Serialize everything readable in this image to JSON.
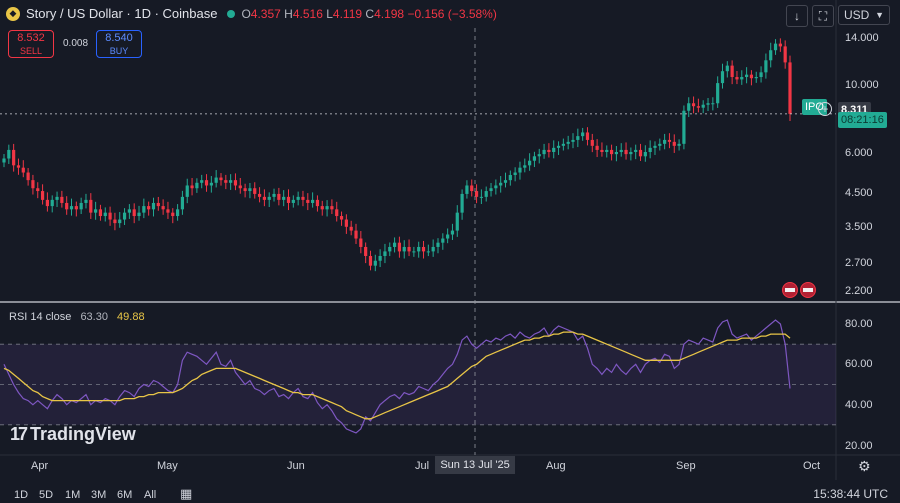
{
  "header": {
    "title": "Story / US Dollar · 1D · Coinbase",
    "open_label": "O",
    "open": "4.357",
    "high_label": "H",
    "high": "4.516",
    "low_label": "L",
    "low": "4.119",
    "close_label": "C",
    "close": "4.198",
    "change": "−0.156 (−3.58%)"
  },
  "trade": {
    "sell_price": "8.532",
    "sell_label": "SELL",
    "spread": "0.008",
    "buy_price": "8.540",
    "buy_label": "BUY"
  },
  "toolbar": {
    "currency": "USD"
  },
  "price_axis": {
    "ticks": [
      "14.000",
      "10.000",
      "8.311",
      "6.000",
      "4.500",
      "3.500",
      "2.700",
      "2.200"
    ],
    "last_price": "8.311",
    "ipo_label": "IPO",
    "countdown": "08:21:16"
  },
  "rsi": {
    "label": "RSI 14 close",
    "value": "63.30",
    "ma_value": "49.88",
    "ticks": [
      "80.00",
      "60.00",
      "40.00",
      "20.00"
    ]
  },
  "time_axis": {
    "labels": [
      "Apr",
      "May",
      "Jun",
      "Jul",
      "Aug",
      "Sep",
      "Oct"
    ],
    "crosshair_label": "Sun 13 Jul '25"
  },
  "watermark": "TradingView",
  "footer": {
    "ranges": [
      "1D",
      "5D",
      "1M",
      "3M",
      "6M",
      "All"
    ],
    "clock": "15:38:44 UTC"
  },
  "colors": {
    "background": "#161a25",
    "up": "#22ab94",
    "down": "#f23645",
    "rsi_line": "#7e57c2",
    "rsi_ma": "#e8c547",
    "accent": "#2962ff"
  },
  "chart_data": {
    "type": "candlestick",
    "y_scale": "log",
    "ylim": [
      2.0,
      16.0
    ],
    "x_range": [
      "2025-03-20",
      "2025-10-05"
    ],
    "closes": [
      5.9,
      6.3,
      5.6,
      5.5,
      5.3,
      5.0,
      4.7,
      4.6,
      4.3,
      4.1,
      4.3,
      4.4,
      4.2,
      4.0,
      4.1,
      4.0,
      4.2,
      4.3,
      3.9,
      4.0,
      3.8,
      3.9,
      3.7,
      3.6,
      3.7,
      3.9,
      4.0,
      3.8,
      3.9,
      4.1,
      4.0,
      4.2,
      4.1,
      4.0,
      3.9,
      3.8,
      4.0,
      4.4,
      4.8,
      4.7,
      4.9,
      5.0,
      4.8,
      4.9,
      5.1,
      5.0,
      4.9,
      5.0,
      4.8,
      4.7,
      4.6,
      4.7,
      4.5,
      4.4,
      4.3,
      4.4,
      4.5,
      4.3,
      4.4,
      4.2,
      4.3,
      4.4,
      4.3,
      4.2,
      4.3,
      4.1,
      4.0,
      4.1,
      4.0,
      3.8,
      3.7,
      3.5,
      3.4,
      3.2,
      3.0,
      2.8,
      2.6,
      2.7,
      2.8,
      2.9,
      3.0,
      3.1,
      2.9,
      3.0,
      2.9,
      2.9,
      3.0,
      2.9,
      2.9,
      3.0,
      3.1,
      3.2,
      3.3,
      3.4,
      3.9,
      4.5,
      4.8,
      4.6,
      4.4,
      4.4,
      4.6,
      4.7,
      4.8,
      4.9,
      5.0,
      5.2,
      5.3,
      5.5,
      5.6,
      5.8,
      6.0,
      6.1,
      6.3,
      6.2,
      6.4,
      6.5,
      6.6,
      6.7,
      6.8,
      7.0,
      7.2,
      6.8,
      6.5,
      6.3,
      6.2,
      6.3,
      6.1,
      6.2,
      6.3,
      6.1,
      6.2,
      6.3,
      6.0,
      6.2,
      6.4,
      6.5,
      6.6,
      6.8,
      6.7,
      6.5,
      6.6,
      8.5,
      9.0,
      8.8,
      8.7,
      8.9,
      9.0,
      9.0,
      10.5,
      11.5,
      12.0,
      11.0,
      10.8,
      11.0,
      11.2,
      10.9,
      11.0,
      11.4,
      12.5,
      13.5,
      14.2,
      13.9,
      12.3,
      8.3
    ],
    "rsi_y_range": [
      20,
      80
    ],
    "rsi_bands": [
      30,
      50,
      70
    ],
    "rsi": [
      60,
      55,
      50,
      46,
      43,
      42,
      40,
      42,
      40,
      38,
      42,
      45,
      43,
      40,
      42,
      41,
      43,
      45,
      40,
      42,
      41,
      43,
      42,
      40,
      44,
      47,
      46,
      44,
      48,
      50,
      49,
      52,
      51,
      49,
      47,
      46,
      50,
      62,
      66,
      65,
      64,
      62,
      60,
      63,
      66,
      60,
      59,
      62,
      56,
      53,
      50,
      52,
      48,
      47,
      45,
      47,
      48,
      44,
      45,
      43,
      46,
      48,
      44,
      43,
      46,
      41,
      38,
      40,
      37,
      33,
      31,
      28,
      27,
      26,
      28,
      34,
      32,
      36,
      40,
      42,
      44,
      45,
      43,
      46,
      45,
      46,
      49,
      48,
      47,
      50,
      52,
      55,
      58,
      60,
      65,
      72,
      74,
      70,
      68,
      70,
      72,
      71,
      73,
      72,
      74,
      75,
      73,
      76,
      74,
      73,
      75,
      76,
      78,
      74,
      77,
      79,
      78,
      77,
      76,
      72,
      74,
      68,
      60,
      58,
      55,
      58,
      56,
      60,
      57,
      55,
      58,
      60,
      56,
      60,
      62,
      63,
      61,
      65,
      64,
      58,
      60,
      70,
      72,
      71,
      70,
      73,
      72,
      71,
      78,
      81,
      82,
      75,
      73,
      74,
      75,
      72,
      74,
      76,
      78,
      80,
      82,
      80,
      70,
      48
    ],
    "rsi_ma": [
      58,
      57,
      55,
      53,
      51,
      49,
      47,
      46,
      44,
      43,
      42,
      42,
      42,
      42,
      42,
      42,
      42,
      42,
      42,
      42,
      42,
      42,
      42,
      42,
      42,
      43,
      43,
      43,
      44,
      44,
      45,
      45,
      46,
      46,
      46,
      46,
      47,
      48,
      50,
      52,
      53,
      55,
      56,
      57,
      58,
      58,
      58,
      58,
      58,
      57,
      56,
      55,
      54,
      53,
      52,
      51,
      50,
      49,
      48,
      47,
      46,
      46,
      45,
      45,
      45,
      44,
      43,
      42,
      41,
      40,
      39,
      37,
      36,
      35,
      34,
      33,
      33,
      34,
      35,
      36,
      37,
      38,
      39,
      40,
      41,
      42,
      43,
      44,
      45,
      46,
      47,
      48,
      49,
      51,
      53,
      55,
      57,
      59,
      60,
      62,
      64,
      65,
      66,
      67,
      68,
      69,
      70,
      71,
      72,
      72,
      73,
      73,
      74,
      74,
      75,
      75,
      76,
      76,
      76,
      75,
      75,
      74,
      73,
      72,
      71,
      70,
      69,
      68,
      67,
      66,
      65,
      64,
      63,
      62,
      62,
      62,
      62,
      62,
      62,
      62,
      62,
      63,
      64,
      65,
      66,
      67,
      68,
      69,
      70,
      71,
      72,
      72,
      72,
      73,
      73,
      73,
      73,
      74,
      74,
      75,
      75,
      75,
      75,
      73
    ]
  }
}
